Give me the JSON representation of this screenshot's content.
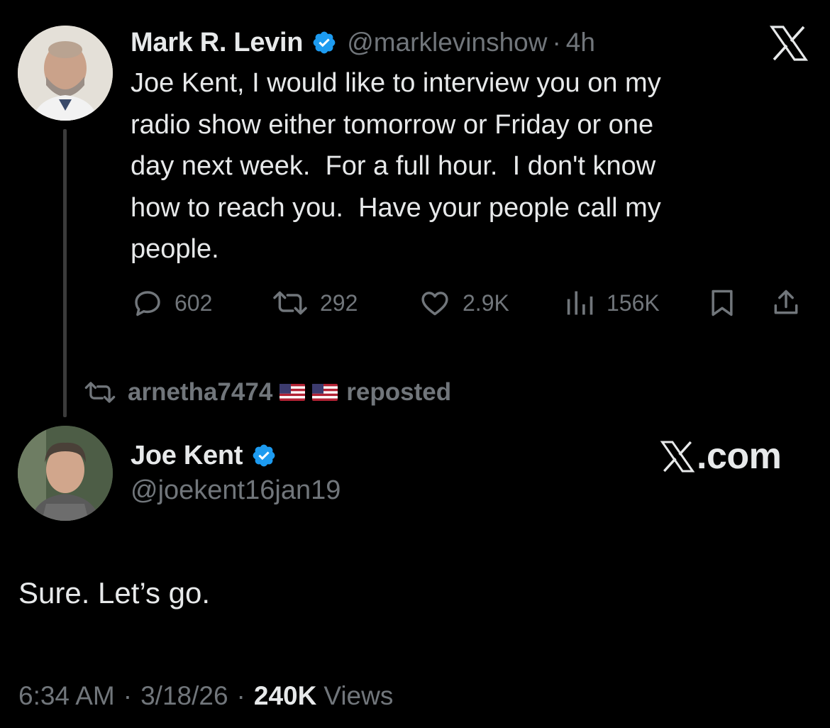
{
  "colors": {
    "background": "#000000",
    "text_primary": "#e7e9ea",
    "text_secondary": "#71767b",
    "verified_blue": "#1d9bf0",
    "thread_line": "#3b3b3b"
  },
  "icons": {
    "verified": "verified-badge-icon",
    "platform": "x-logo-icon",
    "reply": "reply-bubble-icon",
    "repost": "repost-icon",
    "like": "heart-icon",
    "views": "views-bars-icon",
    "bookmark": "bookmark-icon",
    "share": "share-upload-icon",
    "flag": "us-flag-emoji"
  },
  "tweet": {
    "author": {
      "display_name": "Mark R. Levin",
      "handle": "@marklevinshow",
      "time": "4h",
      "separator": "·"
    },
    "text": "Joe Kent, I would like to interview you on my\nradio show either tomorrow or Friday or one\nday next week.  For a full hour.  I don't know\nhow to reach you.  Have your people call my\npeople.",
    "stats": {
      "replies": "602",
      "reposts": "292",
      "likes": "2.9K",
      "views": "156K"
    }
  },
  "repost": {
    "user": "arnetha7474",
    "label": "reposted"
  },
  "reply": {
    "author": {
      "display_name": "Joe Kent",
      "handle": "@joekent16jan19"
    },
    "brand": ".com",
    "text": "Sure. Let’s go.",
    "meta": {
      "time": "6:34 AM",
      "date": "3/18/26",
      "separator": "·",
      "views_count": "240K",
      "views_label": "Views"
    }
  }
}
